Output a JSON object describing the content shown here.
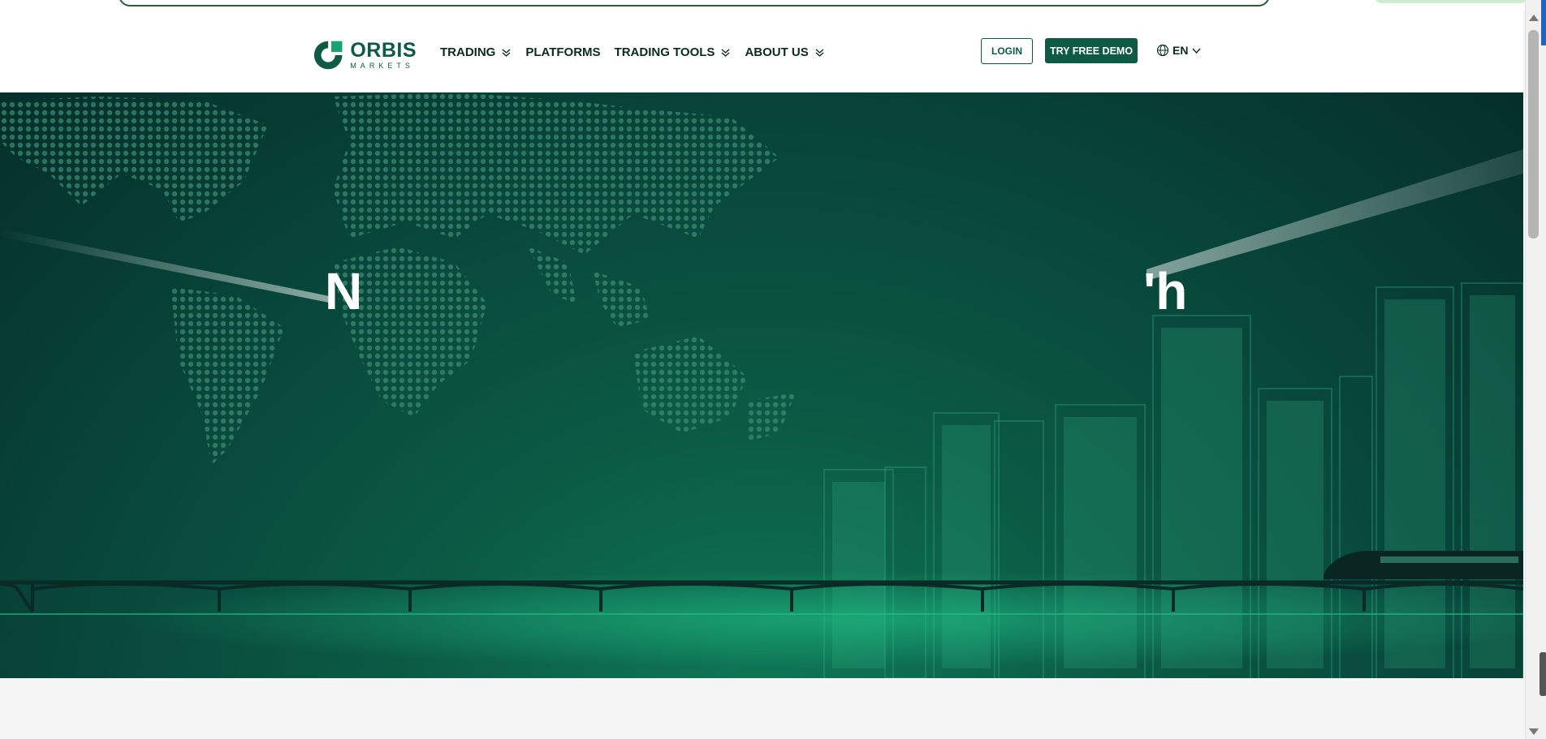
{
  "brand": {
    "name": "ORBIS",
    "subtitle": "MARKETS",
    "primary_color": "#0e5a45",
    "accent_color": "#18a36f"
  },
  "nav": {
    "items": [
      {
        "label": "TRADING",
        "has_dropdown": true
      },
      {
        "label": "PLATFORMS",
        "has_dropdown": false
      },
      {
        "label": "TRADING TOOLS",
        "has_dropdown": true
      },
      {
        "label": "ABOUT US",
        "has_dropdown": true
      }
    ],
    "login_label": "LOGIN",
    "demo_label": "TRY FREE DEMO",
    "language": "EN"
  },
  "hero": {
    "title_left": "N",
    "title_right": "'h"
  },
  "icons": [
    "orbis-logo-icon",
    "chevron-down-icon",
    "globe-icon"
  ]
}
